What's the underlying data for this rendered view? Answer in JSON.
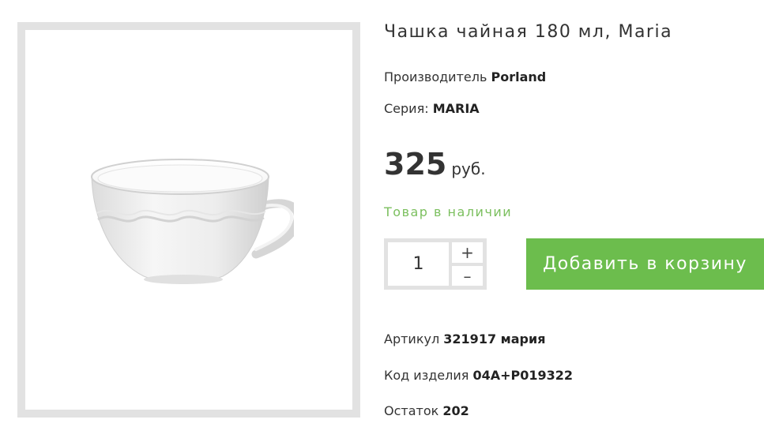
{
  "product": {
    "title": "Чашка чайная 180 мл, Maria",
    "image_alt": "cup-image",
    "manufacturer_label": "Производитель",
    "manufacturer_value": "Porland",
    "series_label": "Серия:",
    "series_value": "MARIA",
    "price_value": "325",
    "price_unit": "руб.",
    "stock_status": "Товар в наличии",
    "article_label": "Артикул",
    "article_value": "321917 мария",
    "code_label": "Код изделия",
    "code_value": "04A+P019322",
    "remain_label": "Остаток",
    "remain_value": "202"
  },
  "quantity": {
    "value": "1",
    "plus": "+",
    "minus": "–"
  },
  "cart": {
    "add_label": "Добавить в корзину"
  },
  "colors": {
    "accent_green": "#6cbd4d",
    "stock_green": "#7bbf5e",
    "frame_gray": "#e2e2e2"
  }
}
